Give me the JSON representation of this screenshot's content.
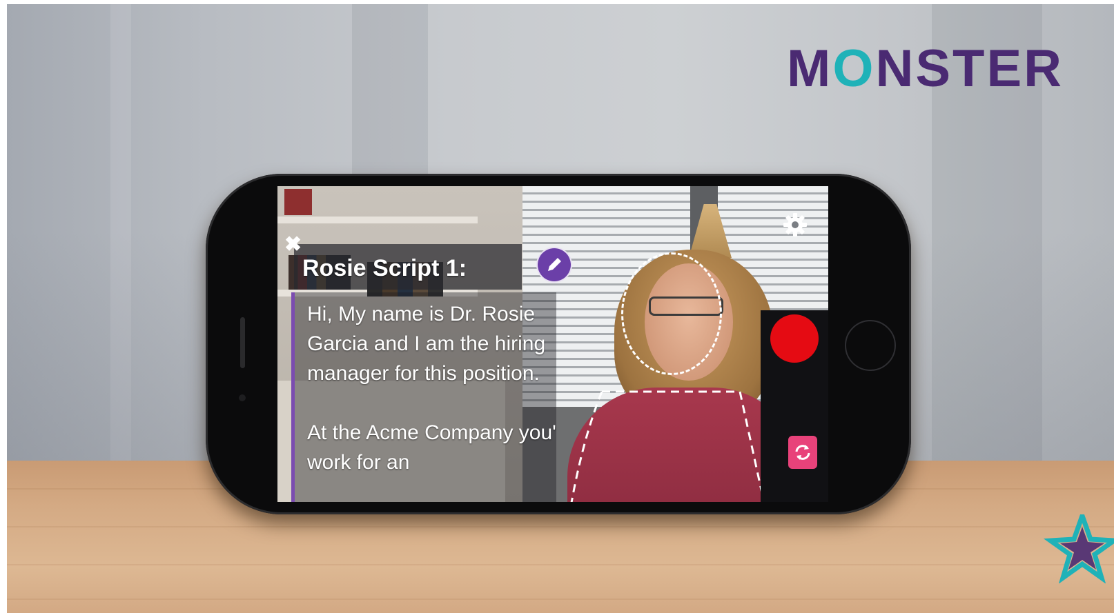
{
  "logo": {
    "before": "M",
    "o": "O",
    "after": "NSTER",
    "color": "#4a2a72",
    "accent": "#1fb2b8"
  },
  "script": {
    "title": "Rosie Script 1:",
    "paragraphs": [
      "Hi, My name is Dr. Rosie Garcia and I am the hiring manager for this position.",
      "At the Acme Company you'll work for an"
    ],
    "accent_color": "#7b4cb0"
  },
  "controls": {
    "close_icon": "close-icon",
    "edit_icon": "pencil-icon",
    "settings_icon": "gear-icon",
    "record_icon": "record-icon",
    "flip_icon": "camera-flip-icon",
    "record_color": "#e50b13",
    "flip_color": "#e8427a"
  },
  "close_glyph": "✖"
}
